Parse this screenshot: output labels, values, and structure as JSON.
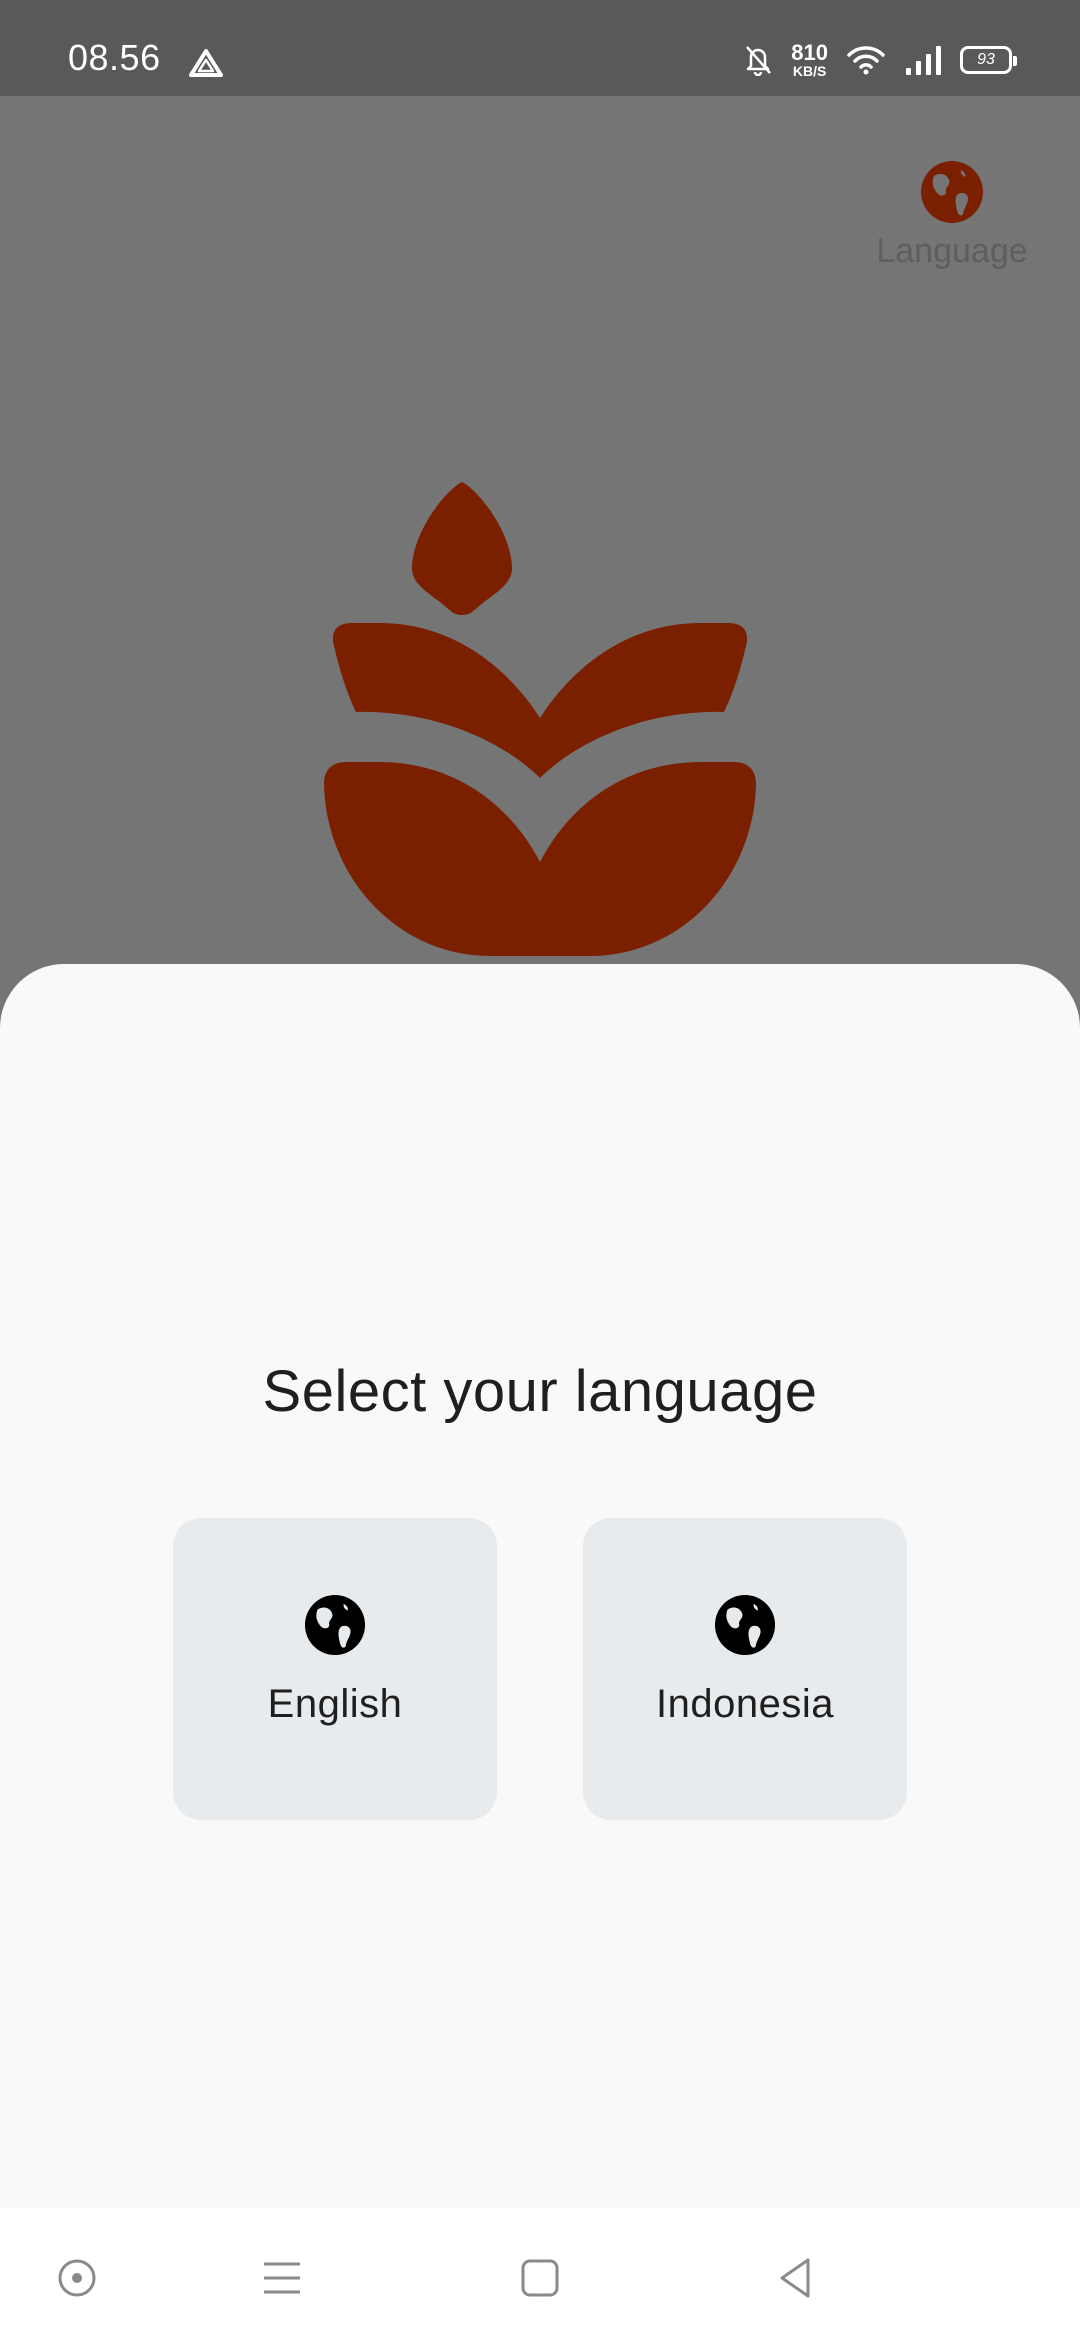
{
  "status_bar": {
    "time": "08.56",
    "speed_value": "810",
    "speed_unit": "KB/S",
    "battery": "93",
    "icons": [
      "drive-icon",
      "mute-bell-icon",
      "wifi-icon",
      "signal-icon",
      "battery-icon"
    ]
  },
  "header": {
    "language_label": "Language",
    "language_icon": "globe-icon"
  },
  "logo": {
    "icon": "lotus-logo",
    "color": "#7a2000"
  },
  "sheet": {
    "title": "Select your language",
    "options": [
      {
        "label": "English",
        "icon": "globe-icon"
      },
      {
        "label": "Indonesia",
        "icon": "globe-icon"
      }
    ]
  },
  "nav_bar": {
    "buttons": [
      "assistant-icon",
      "menu-icon",
      "home-square-icon",
      "back-icon"
    ]
  },
  "colors": {
    "accent": "#7a2000",
    "overlay": "#757575",
    "status_bar": "#595959",
    "sheet": "#f9f9f9",
    "card": "#e8ebee"
  }
}
